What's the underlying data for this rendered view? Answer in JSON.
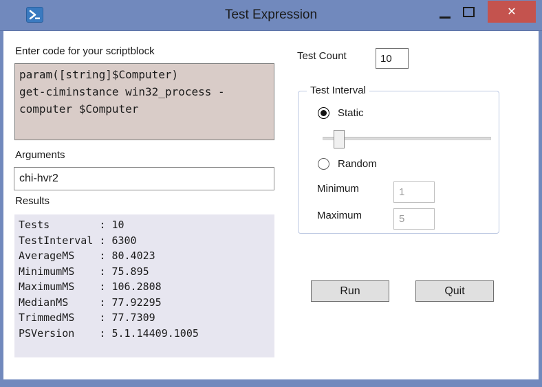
{
  "window": {
    "title": "Test Expression"
  },
  "icons": {
    "powershell": "powershell-prompt",
    "minimize": "minimize-dash",
    "maximize": "maximize-square",
    "close_glyph": "✕"
  },
  "scriptblock": {
    "label": "Enter code for your scriptblock",
    "code_lines": [
      "param([string]$Computer)",
      "get-ciminstance win32_process -",
      "computer $Computer"
    ]
  },
  "arguments": {
    "label": "Arguments",
    "value": "chi-hvr2"
  },
  "results": {
    "label": "Results",
    "lines": [
      "Tests        : 10",
      "TestInterval : 6300",
      "AverageMS    : 80.4023",
      "MinimumMS    : 75.895",
      "MaximumMS    : 106.2808",
      "MedianMS     : 77.92295",
      "TrimmedMS    : 77.7309",
      "PSVersion    : 5.1.14409.1005"
    ]
  },
  "test_count": {
    "label": "Test Count",
    "value": "10"
  },
  "test_interval": {
    "label": "Test Interval",
    "static_label": "Static",
    "random_label": "Random",
    "selected_option": "Static",
    "minimum_label": "Minimum",
    "minimum_value": "1",
    "maximum_label": "Maximum",
    "maximum_value": "5"
  },
  "actions": {
    "run": "Run",
    "quit": "Quit"
  },
  "colors": {
    "titlebar": "#7189bd",
    "close_button": "#c4534e",
    "code_background": "#d9ccc8",
    "results_background": "#e7e6f0",
    "group_border": "#bcc8e2"
  }
}
